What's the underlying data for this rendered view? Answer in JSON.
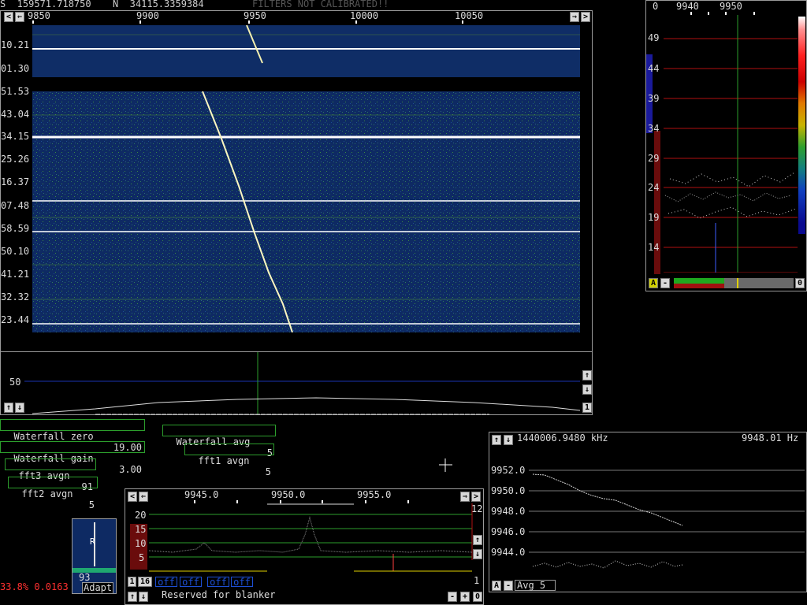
{
  "top_status": {
    "s_value": "S  159571.718750",
    "n_value": "N  34115.3359384",
    "warning": "FILTERS NOT CALIBRATED!!"
  },
  "waterfall": {
    "freq_labels": [
      "9850",
      "9900",
      "9950",
      "10000",
      "10050"
    ],
    "time_labels": [
      "10.21",
      "01.30",
      "51.53",
      "43.04",
      "34.15",
      "25.26",
      "16.37",
      "07.48",
      "58.59",
      "50.10",
      "41.21",
      "32.32",
      "23.44"
    ]
  },
  "spectrum_main": {
    "level_label": "50",
    "btn_up": "↑",
    "btn_down": "↓",
    "btn_one": "1"
  },
  "controls": {
    "waterfall_zero": "Waterfall zero",
    "waterfall_zero_value": "19.00",
    "waterfall_gain": "Waterfall gain",
    "waterfall_gain_value": "3.00",
    "waterfall_avg": "Waterfall avg",
    "waterfall_avg_value": "5",
    "fft1_avgn": "fft1 avgn",
    "fft1_avgn_value": "5",
    "fft3_avgn": "fft3 avgn",
    "fft3_avgn_value": "91",
    "fft2_avgn": "fft2 avgn",
    "fft2_avgn_value": "5"
  },
  "s_meter": {
    "freq_labels": [
      "0",
      "9940",
      "9950"
    ],
    "y_labels": [
      "49",
      "44",
      "39",
      "34",
      "29",
      "24",
      "19",
      "14"
    ],
    "btn_a": "A",
    "btn_minus": "-",
    "btn_o": "0"
  },
  "hires": {
    "freq_labels": [
      "9945.0",
      "9950.0",
      "9955.0"
    ],
    "y_labels": [
      "20",
      "15",
      "10",
      "5"
    ],
    "right_value": "12",
    "right_bottom": "1",
    "btn_one": "1",
    "btn_sixteen": "16",
    "off_labels": [
      "off",
      "off",
      "off",
      "off"
    ],
    "blanker_text": "Reserved for blanker",
    "btn_minus": "-",
    "btn_plus": "+",
    "btn_o": "0"
  },
  "freq_track": {
    "header_left": "1440006.9480 kHz",
    "header_right": "9948.01 Hz",
    "y_labels": [
      "9952.0",
      "9950.0",
      "9948.0",
      "9946.0",
      "9944.0"
    ],
    "btn_a": "A",
    "btn_minus": "-",
    "avg_label": "Avg  5"
  },
  "afc": {
    "value": "93",
    "mode": "Adapt"
  },
  "bottom_status": {
    "text": "33.8% 0.0163"
  },
  "colors": {
    "panel_border": "#9a9a9a",
    "green_box": "#2c9e2c",
    "grid_red": "#b01010",
    "status_red": "#ff3030",
    "waterfall_bg": "#0e2a63"
  }
}
